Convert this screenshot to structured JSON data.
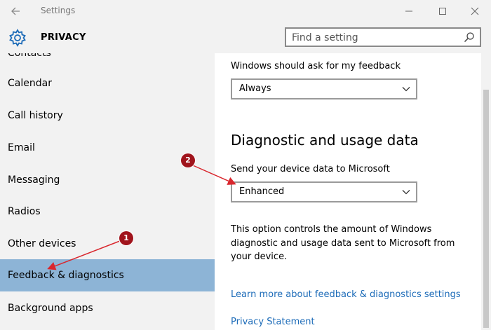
{
  "window": {
    "title": "Settings",
    "back_icon": "back-arrow-icon",
    "controls": {
      "minimize": "minimize-icon",
      "maximize": "maximize-icon",
      "close": "close-icon"
    }
  },
  "header": {
    "section_title": "PRIVACY",
    "section_icon": "gear-icon",
    "search": {
      "placeholder": "Find a setting",
      "value": ""
    }
  },
  "sidebar": {
    "items": [
      {
        "label": "Contacts"
      },
      {
        "label": "Calendar"
      },
      {
        "label": "Call history"
      },
      {
        "label": "Email"
      },
      {
        "label": "Messaging"
      },
      {
        "label": "Radios"
      },
      {
        "label": "Other devices"
      },
      {
        "label": "Feedback & diagnostics",
        "selected": true
      },
      {
        "label": "Background apps"
      }
    ]
  },
  "main": {
    "feedback_label": "Windows should ask for my feedback",
    "feedback_value": "Always",
    "diag_heading": "Diagnostic and usage data",
    "diag_label": "Send your device data to Microsoft",
    "diag_value": "Enhanced",
    "description": "This option controls the amount of Windows diagnostic and usage data sent to Microsoft from your device.",
    "link_learn_more": "Learn more about feedback & diagnostics settings",
    "link_privacy": "Privacy Statement"
  },
  "annotations": {
    "badge_1": "1",
    "badge_2": "2",
    "color": "#a0141c"
  }
}
